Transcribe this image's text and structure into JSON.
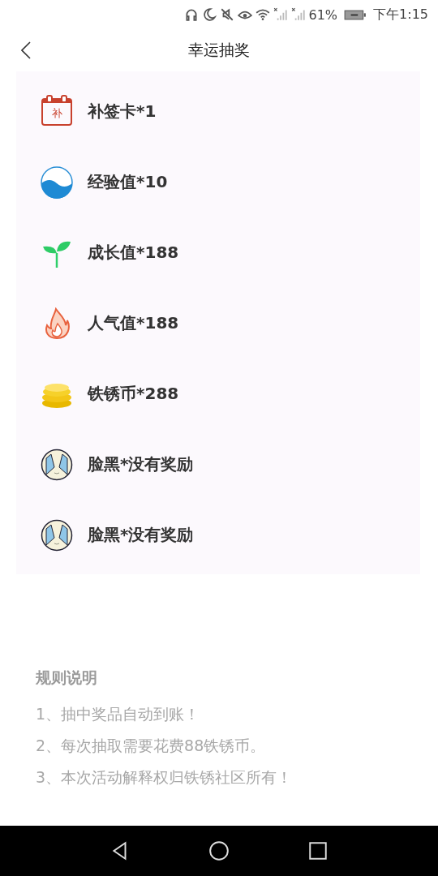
{
  "status_bar": {
    "battery": "61%",
    "time": "下午1:15"
  },
  "header": {
    "title": "幸运抽奖"
  },
  "prizes": [
    {
      "kind": "calendar",
      "icon_label": "补",
      "label": "补签卡*1"
    },
    {
      "kind": "drop",
      "label": "经验值*10"
    },
    {
      "kind": "sprout",
      "label": "成长值*188"
    },
    {
      "kind": "flame",
      "label": "人气值*188"
    },
    {
      "kind": "coins",
      "label": "铁锈币*288"
    },
    {
      "kind": "face",
      "label": "脸黑*没有奖励"
    },
    {
      "kind": "face",
      "label": "脸黑*没有奖励"
    }
  ],
  "rules": {
    "title": "规则说明",
    "lines": [
      "1、抽中奖品自动到账！",
      "2、每次抽取需要花费88铁锈币。",
      "3、本次活动解释权归铁锈社区所有！"
    ]
  }
}
